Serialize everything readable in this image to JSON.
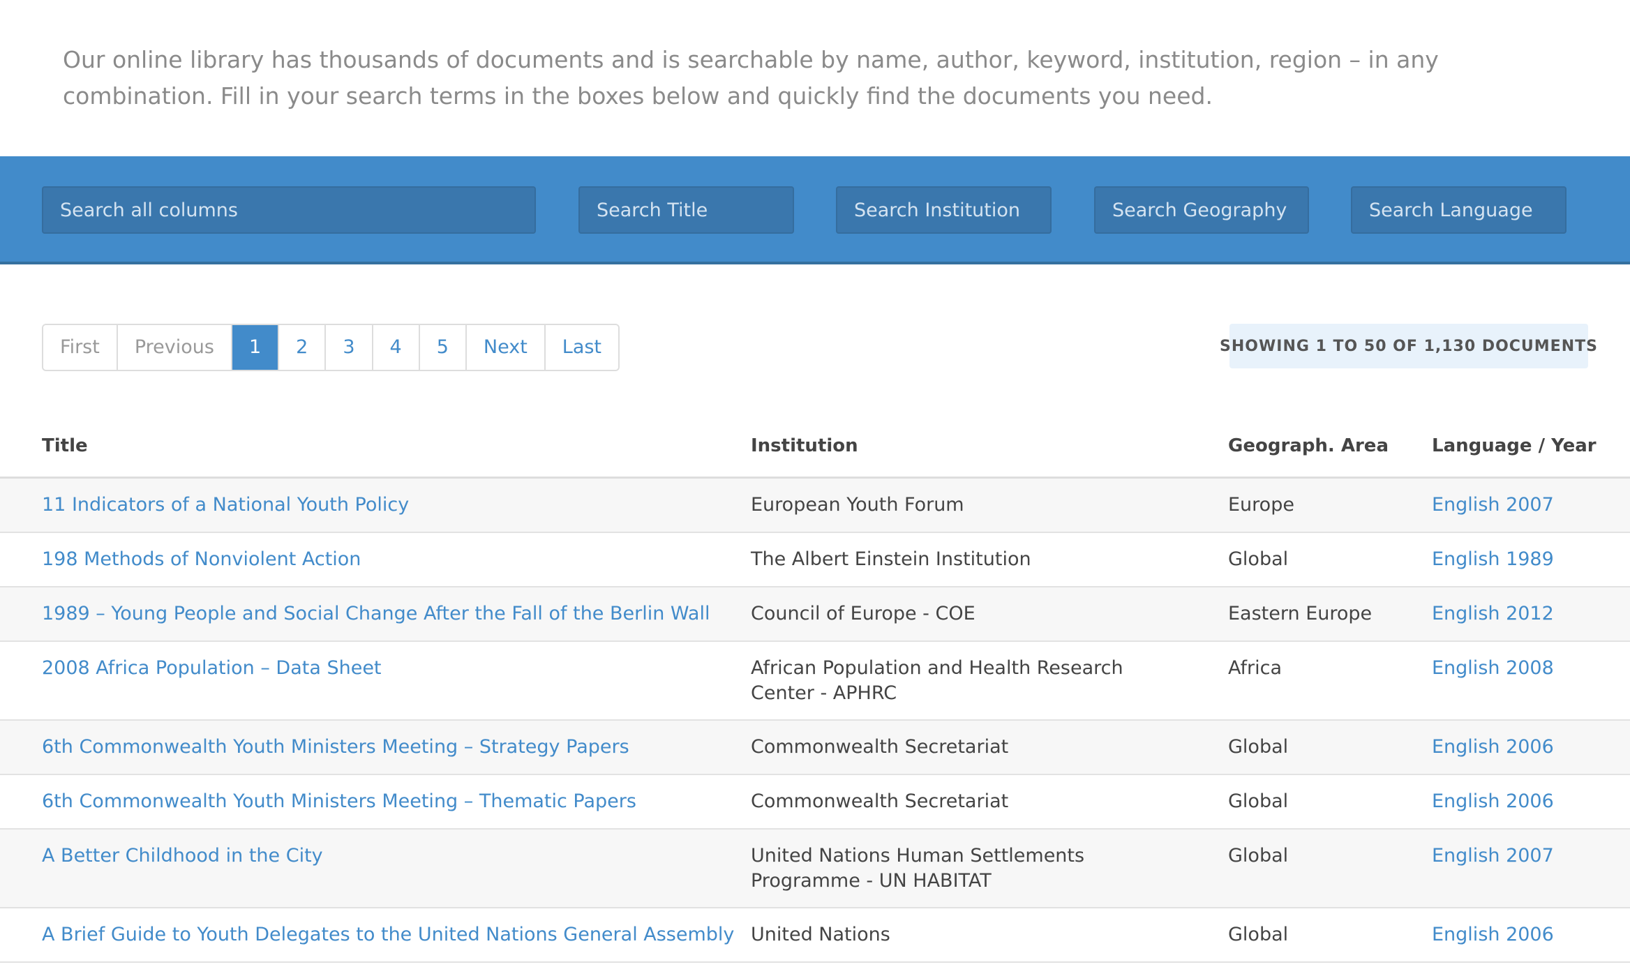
{
  "intro": {
    "text": "Our online library has thousands of documents and is searchable by name, author, keyword, institution, region – in any combination. Fill in your search terms in the boxes below and quickly find the documents you need."
  },
  "search": {
    "all_placeholder": "Search all columns",
    "title_placeholder": "Search Title",
    "institution_placeholder": "Search Institution",
    "geography_placeholder": "Search Geography",
    "language_placeholder": "Search Language"
  },
  "pagination": {
    "first": "First",
    "previous": "Previous",
    "pages": [
      "1",
      "2",
      "3",
      "4",
      "5"
    ],
    "current_page": "1",
    "next": "Next",
    "last": "Last"
  },
  "showing_text": "SHOWING 1 TO 50 OF 1,130 DOCUMENTS",
  "table": {
    "headers": {
      "title": "Title",
      "institution": "Institution",
      "geography": "Geograph. Area",
      "language_year": "Language / Year"
    },
    "rows": [
      {
        "title": "11 Indicators of a National Youth Policy",
        "institution": "European Youth Forum",
        "geography": "Europe",
        "language_year": "English 2007"
      },
      {
        "title": "198 Methods of Nonviolent Action",
        "institution": "The Albert Einstein Institution",
        "geography": "Global",
        "language_year": "English 1989"
      },
      {
        "title": "1989 – Young People and Social Change After the Fall of the Berlin Wall",
        "institution": "Council of Europe - COE",
        "geography": "Eastern Europe",
        "language_year": "English 2012"
      },
      {
        "title": "2008 Africa Population – Data Sheet",
        "institution": "African Population and Health Research Center - APHRC",
        "geography": "Africa",
        "language_year": "English 2008"
      },
      {
        "title": "6th Commonwealth Youth Ministers Meeting – Strategy Papers",
        "institution": "Commonwealth Secretariat",
        "geography": "Global",
        "language_year": "English 2006"
      },
      {
        "title": "6th Commonwealth Youth Ministers Meeting – Thematic Papers",
        "institution": "Commonwealth Secretariat",
        "geography": "Global",
        "language_year": "English 2006"
      },
      {
        "title": "A Better Childhood in the City",
        "institution": "United Nations Human Settlements Programme - UN HABITAT",
        "geography": "Global",
        "language_year": "English 2007"
      },
      {
        "title": "A Brief Guide to Youth Delegates to the United Nations General Assembly",
        "institution": "United Nations",
        "geography": "Global",
        "language_year": "English 2006"
      }
    ]
  },
  "colors": {
    "accent": "#428bca",
    "search_band": "#428bca",
    "stripe": "#f7f7f7",
    "showing_bg": "#e8f2fb"
  }
}
